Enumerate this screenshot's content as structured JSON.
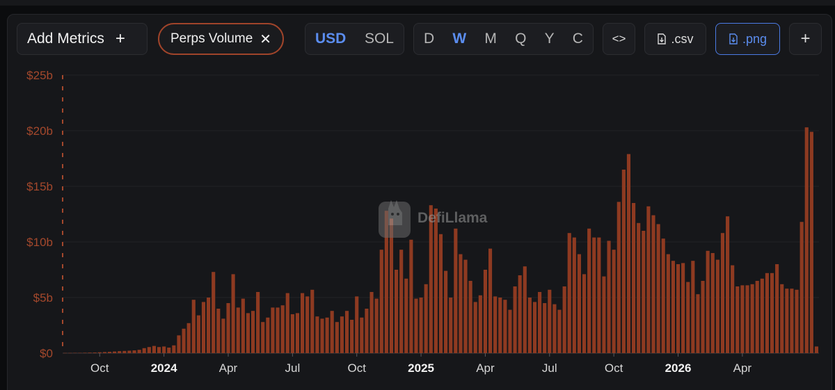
{
  "toolbar": {
    "add_metrics_label": "Add Metrics",
    "add_metrics_icon": "+",
    "metric_pill_label": "Perps Volume",
    "metric_pill_close": "✕",
    "currency_options": [
      "USD",
      "SOL"
    ],
    "currency_selected": "USD",
    "period_options": [
      "D",
      "W",
      "M",
      "Q",
      "Y",
      "C"
    ],
    "period_selected": "W",
    "embed_label": "<>",
    "csv_label": ".csv",
    "png_label": ".png",
    "add_label": "+"
  },
  "watermark": {
    "text": "DefiLlama"
  },
  "colors": {
    "bar": "#8e3a21",
    "accent": "#5b8def",
    "pill_border": "#a0442a",
    "axis_text": "#a4482c"
  },
  "chart_data": {
    "type": "bar",
    "title": "",
    "xlabel": "",
    "ylabel": "",
    "ylim": [
      0,
      25
    ],
    "y_unit": "billion USD",
    "y_ticks": [
      "$0",
      "$5b",
      "$10b",
      "$15b",
      "$20b",
      "$25b"
    ],
    "x_ticks": [
      {
        "label": "Oct",
        "bold": false,
        "index": 7
      },
      {
        "label": "2024",
        "bold": true,
        "index": 20
      },
      {
        "label": "Apr",
        "bold": false,
        "index": 33
      },
      {
        "label": "Jul",
        "bold": false,
        "index": 46
      },
      {
        "label": "Oct",
        "bold": false,
        "index": 59
      },
      {
        "label": "2025",
        "bold": true,
        "index": 72
      },
      {
        "label": "Apr",
        "bold": false,
        "index": 85
      },
      {
        "label": "Jul",
        "bold": false,
        "index": 98
      },
      {
        "label": "Oct",
        "bold": false,
        "index": 111
      },
      {
        "label": "2026",
        "bold": true,
        "index": 124
      },
      {
        "label": "Apr",
        "bold": false,
        "index": 137
      }
    ],
    "series": [
      {
        "values": [
          0.02,
          0.02,
          0.03,
          0.03,
          0.04,
          0.05,
          0.06,
          0.08,
          0.1,
          0.12,
          0.15,
          0.18,
          0.2,
          0.22,
          0.25,
          0.3,
          0.45,
          0.55,
          0.65,
          0.55,
          0.6,
          0.5,
          0.7,
          1.6,
          2.2,
          2.7,
          4.8,
          3.4,
          4.6,
          5.0,
          7.3,
          4.0,
          3.1,
          4.5,
          7.1,
          4.1,
          4.9,
          3.6,
          3.8,
          5.5,
          2.8,
          3.2,
          4.1,
          4.1,
          4.3,
          5.4,
          3.5,
          3.6,
          5.4,
          5.1,
          5.7,
          3.3,
          3.1,
          3.2,
          3.8,
          2.8,
          3.3,
          3.8,
          3.0,
          5.1,
          3.2,
          4.0,
          5.5,
          4.9,
          9.3,
          12.8,
          12.1,
          7.5,
          9.3,
          6.7,
          10.2,
          4.9,
          5.0,
          6.2,
          13.3,
          13.0,
          10.7,
          7.4,
          5.0,
          11.2,
          8.9,
          8.4,
          6.5,
          4.6,
          5.2,
          7.5,
          9.4,
          5.1,
          5.0,
          4.8,
          3.9,
          6.0,
          7.0,
          7.8,
          5.0,
          4.6,
          5.5,
          4.5,
          5.7,
          4.4,
          3.9,
          6.0,
          10.8,
          10.4,
          8.9,
          7.1,
          11.2,
          10.4,
          10.4,
          6.9,
          10.1,
          9.3,
          13.6,
          16.5,
          17.9,
          13.5,
          11.7,
          11.0,
          13.2,
          12.4,
          11.6,
          10.3,
          8.9,
          8.3,
          8.0,
          8.1,
          6.4,
          8.3,
          5.3,
          6.5,
          9.2,
          9.0,
          8.4,
          10.8,
          12.3,
          7.9,
          6.0,
          6.1,
          6.1,
          6.2,
          6.5,
          6.7,
          7.2,
          7.2,
          8.0,
          6.2,
          5.8,
          5.8,
          5.7,
          11.8,
          20.3,
          19.9,
          0.6
        ]
      }
    ],
    "grid": true,
    "legend": "none"
  }
}
